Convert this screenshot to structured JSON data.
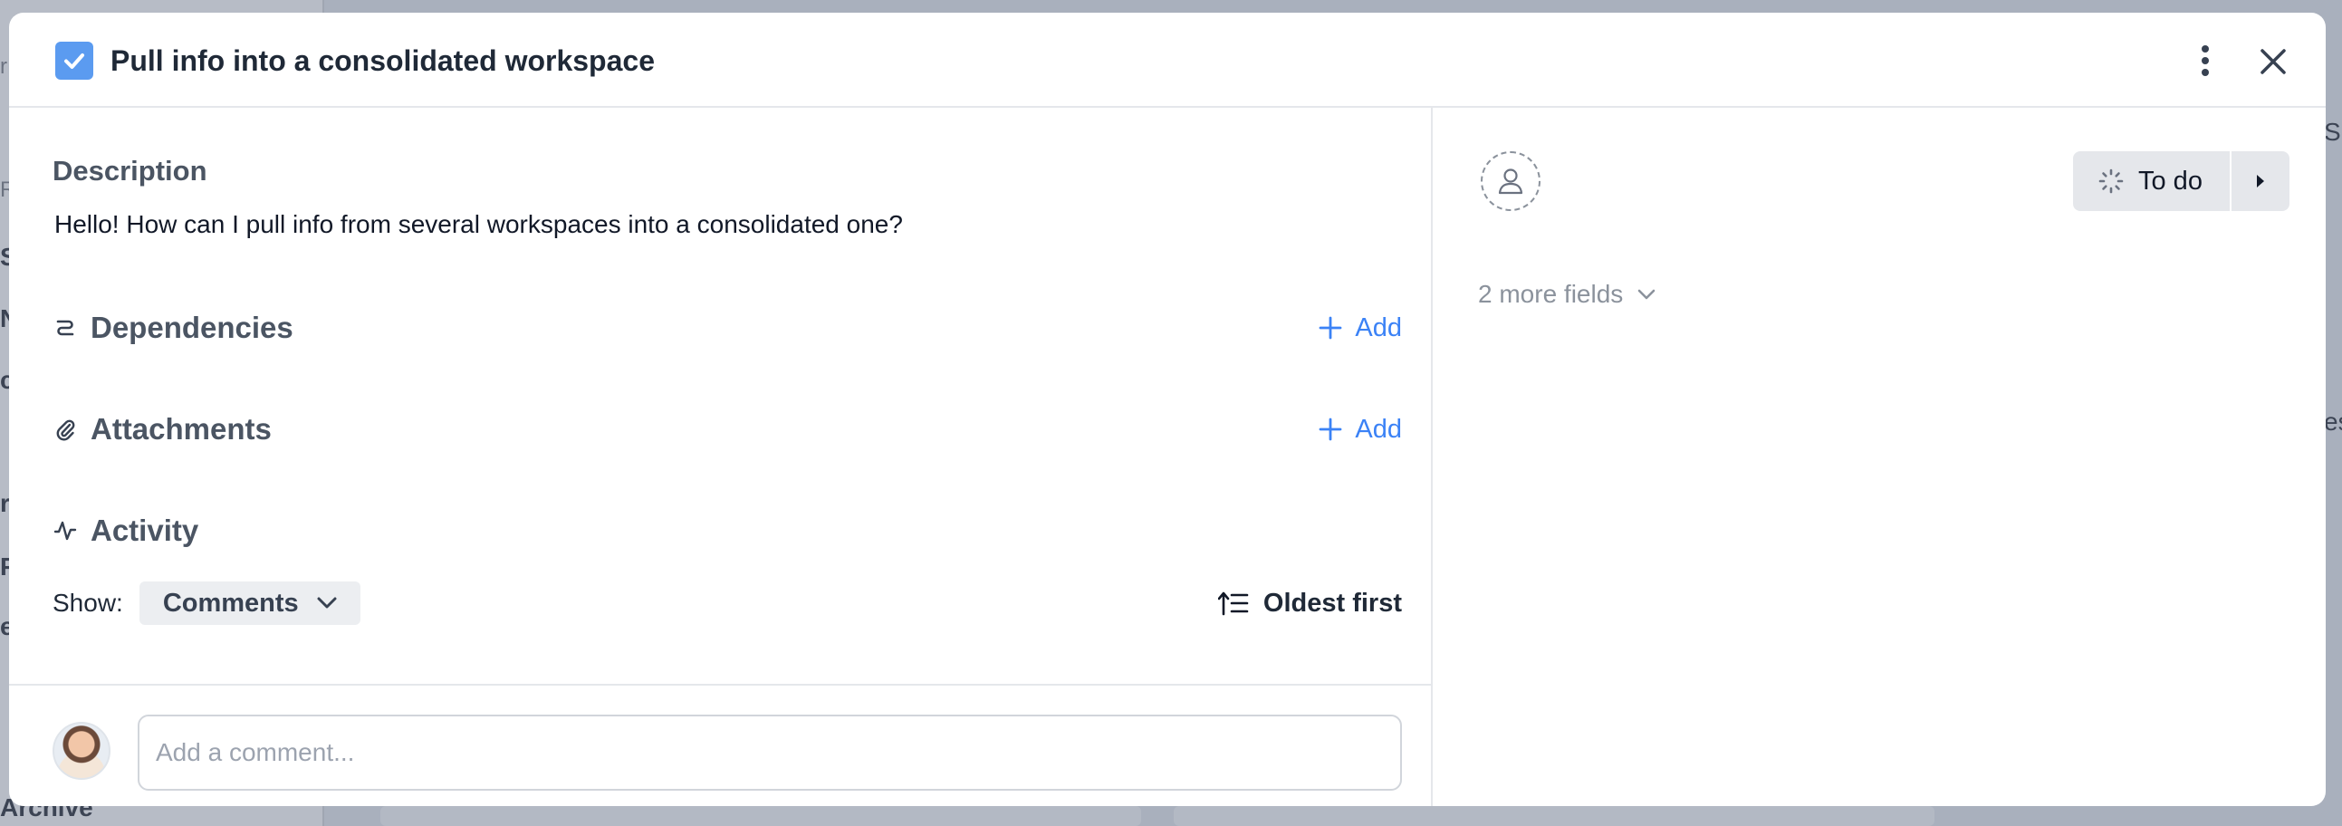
{
  "background": {
    "sidebar_peek": [
      "r",
      "R",
      "S",
      "N",
      "c",
      "rl",
      "Pl",
      "e",
      "Archive"
    ],
    "right_peek": [
      "Sh",
      "es"
    ]
  },
  "modal": {
    "title": "Pull info into a consolidated workspace",
    "description": {
      "heading": "Description",
      "text": "Hello! How can I pull info from several workspaces into a consolidated one?"
    },
    "sections": {
      "dependencies": {
        "label": "Dependencies",
        "add_label": "Add"
      },
      "attachments": {
        "label": "Attachments",
        "add_label": "Add"
      },
      "activity": {
        "label": "Activity"
      }
    },
    "activity": {
      "show_label": "Show:",
      "filter_value": "Comments",
      "sort_label": "Oldest first"
    },
    "comment": {
      "placeholder": "Add a comment..."
    },
    "sidebar": {
      "status_label": "To do",
      "more_fields_label": "2 more fields"
    }
  },
  "colors": {
    "accent": "#3b82f6",
    "checkbox": "#5b9bf0",
    "overlay": "#9aa3b4"
  },
  "icons": [
    "checkbox-icon",
    "kebab-icon",
    "close-icon",
    "dependencies-icon",
    "paperclip-icon",
    "activity-icon",
    "plus-icon",
    "chevron-down-icon",
    "sort-icon",
    "user-icon",
    "loading-icon",
    "caret-right-icon"
  ]
}
